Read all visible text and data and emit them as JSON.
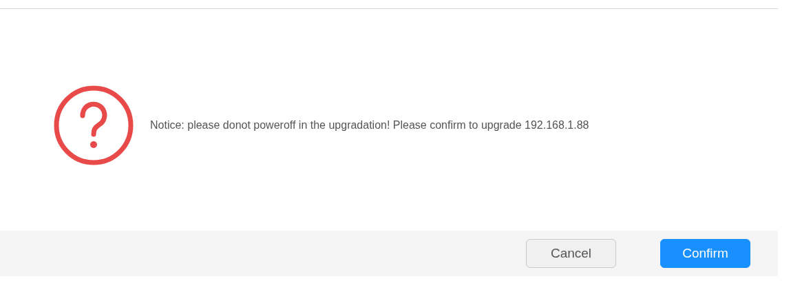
{
  "dialog": {
    "message": "Notice: please donot poweroff in the upgradation! Please confirm to upgrade 192.168.1.88"
  },
  "buttons": [
    {
      "label": "Cancel",
      "kind": "secondary"
    },
    {
      "label": "Confirm",
      "kind": "primary"
    }
  ]
}
